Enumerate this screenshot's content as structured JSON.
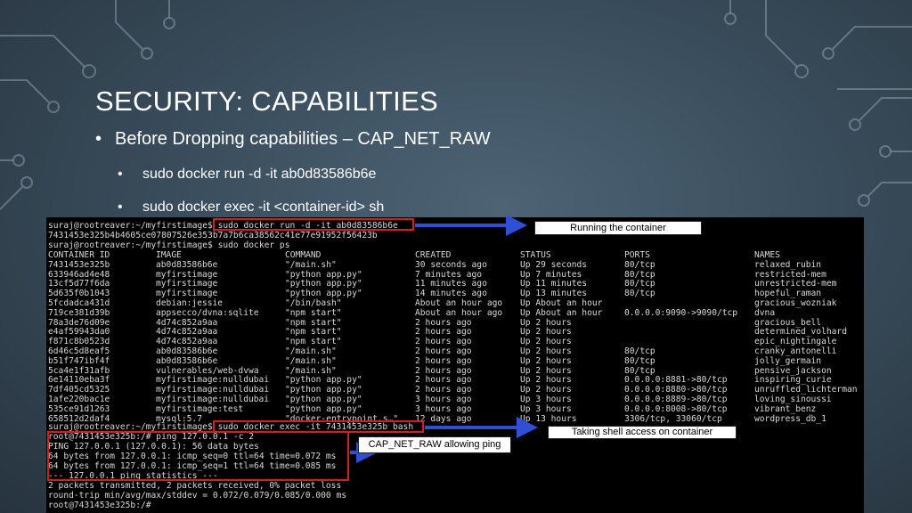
{
  "slide": {
    "title": "SECURITY: CAPABILITIES",
    "bullets": [
      {
        "text": "Before Dropping capabilities – CAP_NET_RAW"
      },
      {
        "text": "sudo docker run -d -it ab0d83586b6e"
      },
      {
        "text": "sudo docker exec -it <container-id> sh"
      }
    ],
    "bullet_glyph": "•"
  },
  "terminal": {
    "header_lines": [
      "suraj@rootreaver:~/myfirstimage$ sudo docker run -d -it ab0d83586b6e",
      "7431453e325b4b4605ce07807526e353b7a7b6ca38562c41e77e91952f56423b",
      "suraj@rootreaver:~/myfirstimage$ sudo docker ps"
    ],
    "ps_headers": [
      "CONTAINER ID",
      "IMAGE",
      "COMMAND",
      "CREATED",
      "STATUS",
      "PORTS",
      "NAMES"
    ],
    "ps_rows": [
      [
        "7431453e325b",
        "ab0d83586b6e",
        "\"/main.sh\"",
        "30 seconds ago",
        "Up 29 seconds",
        "80/tcp",
        "relaxed_rubin"
      ],
      [
        "633946ad4e48",
        "myfirstimage",
        "\"python app.py\"",
        "7 minutes ago",
        "Up 7 minutes",
        "80/tcp",
        "restricted-mem"
      ],
      [
        "13cf5d77f6da",
        "myfirstimage",
        "\"python app.py\"",
        "11 minutes ago",
        "Up 11 minutes",
        "80/tcp",
        "unrestricted-mem"
      ],
      [
        "5d635f0b1043",
        "myfirstimage",
        "\"python app.py\"",
        "14 minutes ago",
        "Up 13 minutes",
        "80/tcp",
        "hopeful_raman"
      ],
      [
        "5fcdadca431d",
        "debian:jessie",
        "\"/bin/bash\"",
        "About an hour ago",
        "Up About an hour",
        "",
        "gracious_wozniak"
      ],
      [
        "719ce381d39b",
        "appsecco/dvna:sqlite",
        "\"npm start\"",
        "About an hour ago",
        "Up About an hour",
        "0.0.0.0:9090->9090/tcp",
        "dvna"
      ],
      [
        "78a3de76d09e",
        "4d74c852a9aa",
        "\"npm start\"",
        "2 hours ago",
        "Up 2 hours",
        "",
        "gracious_bell"
      ],
      [
        "e4af59943da0",
        "4d74c852a9aa",
        "\"npm start\"",
        "2 hours ago",
        "Up 2 hours",
        "",
        "determined_volhard"
      ],
      [
        "f871c8b0523d",
        "4d74c852a9aa",
        "\"npm start\"",
        "2 hours ago",
        "Up 2 hours",
        "",
        "epic_nightingale"
      ],
      [
        "6d46c5d8eaf5",
        "ab0d83586b6e",
        "\"/main.sh\"",
        "2 hours ago",
        "Up 2 hours",
        "80/tcp",
        "cranky_antonelli"
      ],
      [
        "b51f747ibf4f",
        "ab0d83586b6e",
        "\"/main.sh\"",
        "2 hours ago",
        "Up 2 hours",
        "80/tcp",
        "jolly_germain"
      ],
      [
        "5ca4e1f31afb",
        "vulnerables/web-dvwa",
        "\"/main.sh\"",
        "2 hours ago",
        "Up 2 hours",
        "80/tcp",
        "pensive_jackson"
      ],
      [
        "6e14110eba3f",
        "myfirstimage:nulldubai",
        "\"python app.py\"",
        "2 hours ago",
        "Up 2 hours",
        "0.0.0.0:8881->80/tcp",
        "inspiring_curie"
      ],
      [
        "7df405cd5325",
        "myfirstimage:nulldubai",
        "\"python app.py\"",
        "2 hours ago",
        "Up 2 hours",
        "0.0.0.0:8880->80/tcp",
        "unruffled_lichterman"
      ],
      [
        "1afe220bac1e",
        "myfirstimage:nulldubai",
        "\"python app.py\"",
        "3 hours ago",
        "Up 3 hours",
        "0.0.0.0:8889->80/tcp",
        "loving_sinoussi"
      ],
      [
        "535ce91d1263",
        "myfirstimage:test",
        "\"python app.py\"",
        "3 hours ago",
        "Up 3 hours",
        "0.0.0.0:8008->80/tcp",
        "vibrant_benz"
      ],
      [
        "658512d2daf4",
        "mysql:5.7",
        "\"docker-entrypoint.s…\"",
        "12 days ago",
        "Up 13 hours",
        "3306/tcp, 33060/tcp",
        "wordpress_db_1"
      ]
    ],
    "footer_lines": [
      "suraj@rootreaver:~/myfirstimage$ sudo docker exec -it 7431453e325b bash",
      "root@7431453e325b:/# ping 127.0.0.1 -c 2",
      "PING 127.0.0.1 (127.0.0.1): 56 data bytes",
      "64 bytes from 127.0.0.1: icmp_seq=0 ttl=64 time=0.072 ms",
      "64 bytes from 127.0.0.1: icmp_seq=1 ttl=64 time=0.085 ms",
      "--- 127.0.0.1 ping statistics ---",
      "2 packets transmitted, 2 packets received, 0% packet loss",
      "round-trip min/avg/max/stddev = 0.072/0.079/0.085/0.000 ms",
      "root@7431453e325b:/# "
    ]
  },
  "callouts": {
    "run": "Running the container",
    "exec": "Taking shell access on container",
    "ping": "CAP_NET_RAW allowing ping"
  },
  "colors": {
    "highlight": "#d22020",
    "arrow": "#2f4fd6",
    "terminal_bg": "#000000",
    "terminal_text": "#d8d8d8"
  }
}
